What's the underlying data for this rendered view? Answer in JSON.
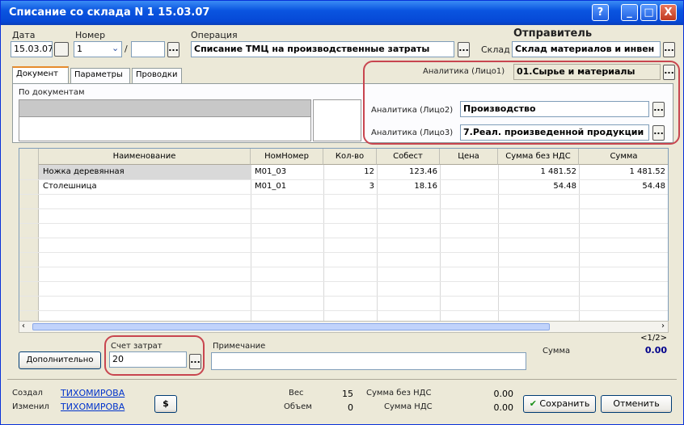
{
  "window": {
    "title": "Списание со склада N 1 15.03.07",
    "help_label": "?",
    "minimize_label": "_",
    "maximize_label": "□",
    "close_label": "X"
  },
  "header": {
    "date_label": "Дата",
    "date_value": "15.03.07",
    "number_label": "Номер",
    "number_value": "1",
    "number_sep": "/",
    "operation_label": "Операция",
    "operation_value": "Списание ТМЦ на производственные затраты",
    "warehouse_label": "Склад",
    "sender_title": "Отправитель",
    "warehouse_value": "Склад материалов и инвен",
    "analytics1_label": "Аналитика (Лицо1)",
    "analytics1_value": "01.Сырье и материалы",
    "analytics2_label": "Аналитика (Лицо2)",
    "analytics2_value": "Производство",
    "analytics3_label": "Аналитика (Лицо3)",
    "analytics3_value": "7.Реал. произведенной продукции",
    "picker_label": "..."
  },
  "tabs": [
    {
      "label": "Документ"
    },
    {
      "label": "Параметры"
    },
    {
      "label": "Проводки"
    }
  ],
  "document_tab": {
    "by_documents_label": "По документам"
  },
  "table": {
    "columns": [
      "Наименование",
      "НомНомер",
      "Кол-во",
      "Собест",
      "Цена",
      "Сумма без НДС",
      "Сумма"
    ],
    "rows": [
      {
        "name": "Ножка деревянная",
        "code": "М01_03",
        "qty": "12",
        "cost": "123.46",
        "price": "",
        "sum_no_vat": "1 481.52",
        "sum": "1 481.52"
      },
      {
        "name": "Столешница",
        "code": "М01_01",
        "qty": "3",
        "cost": "18.16",
        "price": "",
        "sum_no_vat": "54.48",
        "sum": "54.48"
      }
    ]
  },
  "bottom": {
    "additional_button": "Дополнительно",
    "cost_account_label": "Счет затрат",
    "cost_account_value": "20",
    "note_label": "Примечание",
    "sum_label": "Сумма",
    "sum_value": "0.00",
    "page_indicator": "<1/2>"
  },
  "footer": {
    "created_label": "Создал",
    "created_value": "ТИХОМИРОВА",
    "modified_label": "Изменил",
    "modified_value": "ТИХОМИРОВА",
    "currency_button": "$",
    "weight_label": "Вес",
    "weight_value": "15",
    "volume_label": "Объем",
    "volume_value": "0",
    "sum_no_vat_label": "Сумма без НДС",
    "sum_no_vat_value": "0.00",
    "sum_vat_label": "Сумма НДС",
    "sum_vat_value": "0.00",
    "save_button": "Сохранить",
    "cancel_button": "Отменить"
  },
  "colors": {
    "title_bar": "#0a55e0",
    "highlight_oval": "#c8454f",
    "selected_row": "#d9d9d9"
  }
}
